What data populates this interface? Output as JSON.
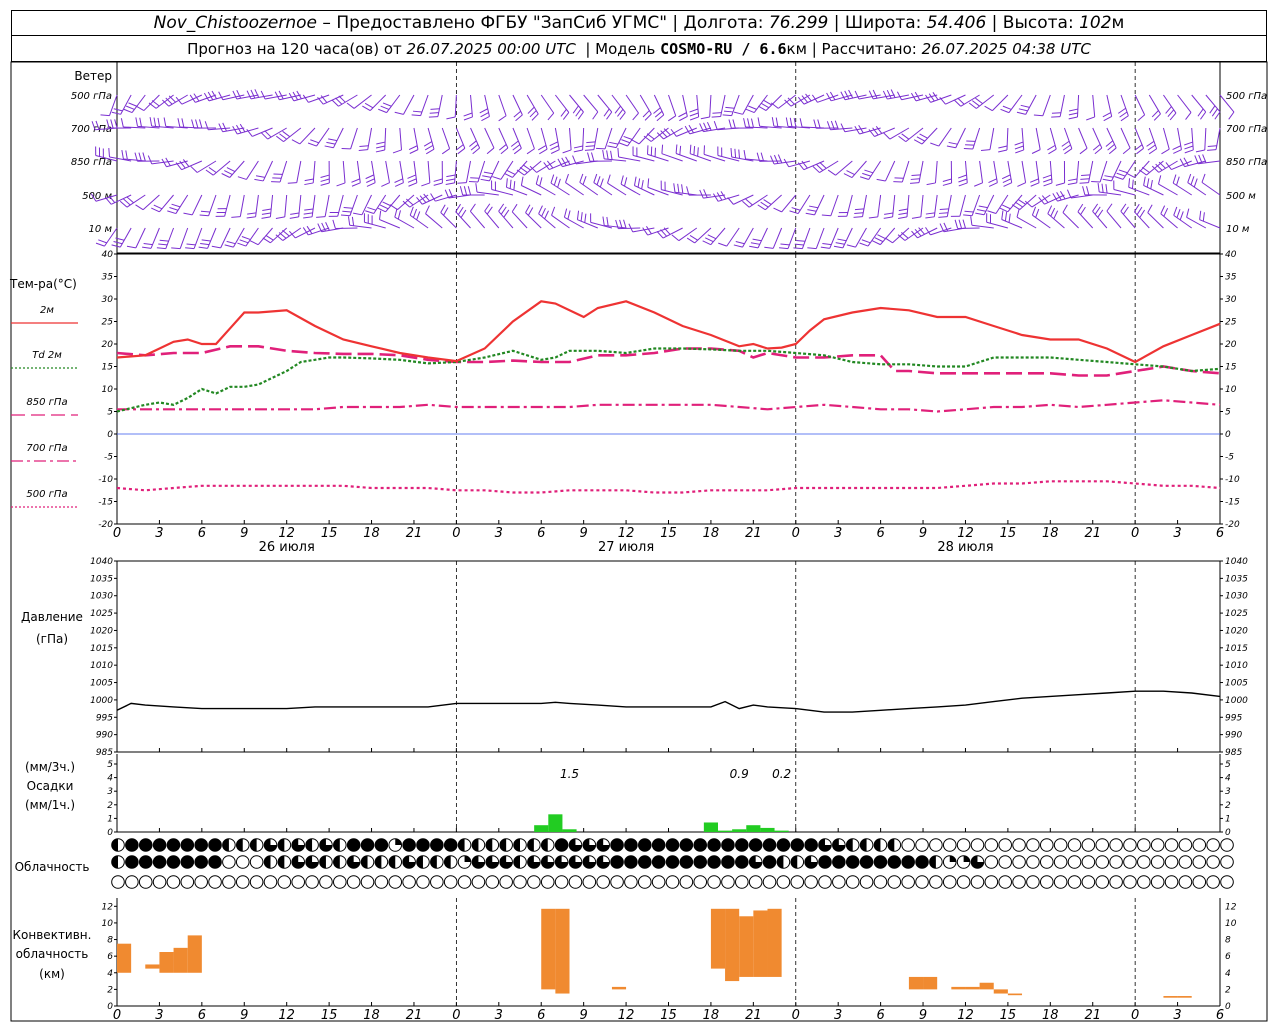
{
  "header": {
    "station": "Nov_Chistoozernoe",
    "provider": " – Предоставлено ФГБУ \"ЗапСиб УГМС\" | Долгота: ",
    "lon": "76.299",
    "lat_label": " | Широта: ",
    "lat": "54.406",
    "alt_label": " | Высота: ",
    "alt": "102",
    "alt_unit": "м",
    "forecast_prefix": "Прогноз на 120 часа(ов) от ",
    "forecast_from": "26.07.2025 00:00 UTC",
    "model_label": "  | Модель ",
    "model": "COSMO-RU / 6.6",
    "model_unit": "км",
    "calc_label": " | Рассчитано: ",
    "calc_time": "26.07.2025 04:38 UTC"
  },
  "wind_panel": {
    "title": "Ветер",
    "levels": [
      "500 гПа",
      "700 гПа",
      "850 гПа",
      "500 м",
      "10  м"
    ],
    "colors": {
      "barb": "#7a2ed0"
    }
  },
  "temp_panel": {
    "title": "Тем-ра(°C)",
    "legend": [
      {
        "label": "2м",
        "color": "#ee3333",
        "style": "solid"
      },
      {
        "label": "Td  2м",
        "color": "#228822",
        "style": "dotted"
      },
      {
        "label": "850 гПа",
        "color": "#e0207a",
        "style": "longdash"
      },
      {
        "label": "700 гПа",
        "color": "#e0207a",
        "style": "dashdot"
      },
      {
        "label": "500 гПа",
        "color": "#e0207a",
        "style": "dotted"
      }
    ]
  },
  "time_axis": {
    "tick_labels": [
      "0",
      "3",
      "6",
      "9",
      "12",
      "15",
      "18",
      "21",
      "0",
      "3",
      "6",
      "9",
      "12",
      "15",
      "18",
      "21",
      "0",
      "3",
      "6",
      "9",
      "12",
      "15",
      "18",
      "21",
      "0",
      "3",
      "6"
    ],
    "day_labels": [
      "26 июля",
      "27 июля",
      "28 июля"
    ]
  },
  "pressure_panel": {
    "title": "Давление",
    "unit": "(гПа)"
  },
  "precip_panel": {
    "unit_top": "(мм/3ч.)",
    "title": "Осадки",
    "unit_bottom": "(мм/1ч.)",
    "annotations": [
      {
        "hour": 32,
        "text": "1.5"
      },
      {
        "hour": 44,
        "text": "0.9"
      },
      {
        "hour": 47,
        "text": "0.2"
      }
    ]
  },
  "cloud_panel": {
    "title": "Облачность",
    "rows": [
      "2444444422232323244414444222222243334444444444444443322220000000000000000000000000000003113",
      "2444444400022332232223222133323333334444444444342234444444421130000000000000000000000000000113",
      "0000000000000000000000000000000000000000000000000000000000000000000000000000000000000000000000"
    ]
  },
  "conv_panel": {
    "title_line1": "Конвективн.",
    "title_line2": "облачность",
    "unit": "(км)"
  },
  "colors": {
    "temp2m": "#ee3333",
    "td": "#228822",
    "upper": "#e0207a",
    "precip": "#22cc22",
    "conv": "#f08a30",
    "zero_line": "#3355ee"
  },
  "chart_data": [
    {
      "type": "line",
      "title": "Тем-ра(°C)",
      "x_unit": "hours from 26.07.2025 00:00 UTC",
      "ylim": [
        -20,
        40
      ],
      "series": [
        {
          "name": "2м",
          "x": [
            0,
            2,
            4,
            5,
            6,
            7,
            8,
            9,
            10,
            12,
            14,
            16,
            18,
            20,
            22,
            24,
            26,
            28,
            30,
            31,
            33,
            34,
            36,
            38,
            40,
            42,
            44,
            45,
            46,
            47,
            48,
            49,
            50,
            52,
            54,
            56,
            58,
            60,
            62,
            63,
            64,
            66,
            68,
            70,
            72,
            74,
            76,
            78
          ],
          "y": [
            17,
            17.5,
            20.5,
            21,
            20,
            20,
            23.5,
            27,
            27,
            27.5,
            24,
            21,
            19.5,
            18,
            17,
            16.2,
            19,
            25,
            29.5,
            29,
            26,
            28,
            29.5,
            27,
            24,
            22,
            19.5,
            20,
            19,
            19.2,
            20,
            23,
            25.5,
            27,
            28,
            27.5,
            26,
            26,
            24,
            23,
            22,
            21,
            21,
            19,
            16,
            19.5,
            22,
            24.5
          ]
        },
        {
          "name": "Td 2м",
          "x": [
            0,
            2,
            3,
            4,
            5,
            6,
            7,
            8,
            9,
            10,
            12,
            13,
            14,
            15,
            16,
            18,
            20,
            22,
            24,
            26,
            28,
            30,
            31,
            32,
            34,
            36,
            38,
            40,
            42,
            44,
            46,
            48,
            50,
            52,
            54,
            56,
            58,
            60,
            62,
            64,
            66,
            68,
            70,
            72,
            74,
            76,
            78
          ],
          "y": [
            5,
            6.5,
            7,
            6.5,
            8,
            10,
            9,
            10.5,
            10.5,
            11,
            14,
            16,
            16.5,
            17,
            17,
            16.8,
            16.5,
            15.7,
            16,
            17,
            18.5,
            16.5,
            17,
            18.5,
            18.5,
            18,
            19,
            19,
            18.8,
            18.5,
            18.5,
            18,
            17.5,
            16,
            15.5,
            15.5,
            15,
            15,
            17,
            17,
            17,
            16.5,
            16,
            15.5,
            15,
            14,
            14.5
          ]
        },
        {
          "name": "850 гПа",
          "x": [
            0,
            2,
            4,
            6,
            8,
            10,
            12,
            14,
            16,
            18,
            20,
            22,
            24,
            26,
            28,
            30,
            32,
            34,
            36,
            38,
            40,
            42,
            44,
            45,
            46,
            48,
            50,
            52,
            54,
            55,
            56,
            58,
            60,
            62,
            64,
            66,
            68,
            70,
            72,
            74,
            76,
            78
          ],
          "y": [
            18,
            17.5,
            18,
            18,
            19.5,
            19.5,
            18.5,
            18,
            17.8,
            17.8,
            17.5,
            16.5,
            16,
            16,
            16.3,
            16,
            16,
            17.5,
            17.5,
            18,
            19,
            19,
            18.5,
            17,
            18,
            17,
            17,
            17.5,
            17.5,
            14,
            14,
            13.5,
            13.5,
            13.5,
            13.5,
            13.5,
            13,
            13,
            14,
            15,
            14,
            13.5
          ]
        },
        {
          "name": "700 гПа",
          "x": [
            0,
            2,
            4,
            6,
            8,
            10,
            12,
            14,
            16,
            18,
            20,
            22,
            24,
            26,
            28,
            30,
            32,
            34,
            36,
            38,
            40,
            42,
            44,
            46,
            48,
            50,
            52,
            54,
            56,
            58,
            60,
            62,
            64,
            66,
            68,
            70,
            72,
            74,
            76,
            78
          ],
          "y": [
            5.5,
            5.5,
            5.5,
            5.5,
            5.5,
            5.5,
            5.5,
            5.5,
            6,
            6,
            6,
            6.5,
            6,
            6,
            6,
            6,
            6,
            6.5,
            6.5,
            6.5,
            6.5,
            6.5,
            6,
            5.5,
            6,
            6.5,
            6,
            5.5,
            5.5,
            5,
            5.5,
            6,
            6,
            6.5,
            6,
            6.5,
            7,
            7.5,
            7,
            6.5
          ]
        },
        {
          "name": "500 гПа",
          "x": [
            0,
            2,
            4,
            6,
            8,
            10,
            12,
            14,
            16,
            18,
            20,
            22,
            24,
            26,
            28,
            30,
            32,
            34,
            36,
            38,
            40,
            42,
            44,
            46,
            48,
            50,
            52,
            54,
            56,
            58,
            60,
            62,
            64,
            66,
            68,
            70,
            72,
            74,
            76,
            78
          ],
          "y": [
            -12,
            -12.5,
            -12,
            -11.5,
            -11.5,
            -11.5,
            -11.5,
            -11.5,
            -11.5,
            -12,
            -12,
            -12,
            -12.5,
            -12.5,
            -13,
            -13,
            -12.5,
            -12.5,
            -12.5,
            -13,
            -13,
            -12.5,
            -12.5,
            -12.5,
            -12,
            -12,
            -12,
            -12,
            -12,
            -12,
            -11.5,
            -11,
            -11,
            -10.5,
            -10.5,
            -10.5,
            -11,
            -11.5,
            -11.5,
            -12
          ]
        }
      ]
    },
    {
      "type": "line",
      "title": "Давление",
      "ylim": [
        985,
        1040
      ],
      "series": [
        {
          "name": "pressure",
          "x": [
            0,
            1,
            2,
            4,
            6,
            8,
            10,
            12,
            14,
            16,
            18,
            20,
            22,
            24,
            26,
            28,
            30,
            31,
            32,
            34,
            36,
            38,
            40,
            42,
            43,
            44,
            45,
            46,
            48,
            50,
            52,
            54,
            56,
            58,
            60,
            62,
            64,
            66,
            68,
            70,
            72,
            74,
            76,
            78
          ],
          "y": [
            997,
            999,
            998.5,
            998,
            997.5,
            997.5,
            997.5,
            997.5,
            998,
            998,
            998,
            998,
            998,
            999,
            999,
            999,
            999,
            999.3,
            999,
            998.5,
            998,
            998,
            998,
            998,
            999.5,
            997.5,
            998.5,
            998,
            997.5,
            996.5,
            996.5,
            997,
            997.5,
            998,
            998.5,
            999.5,
            1000.5,
            1001,
            1001.5,
            1002,
            1002.5,
            1002.5,
            1002,
            1001
          ]
        }
      ]
    },
    {
      "type": "bar",
      "title": "Осадки",
      "ylim": [
        0,
        5
      ],
      "series": [
        {
          "name": "precip 1h",
          "x": [
            30,
            31,
            32,
            42,
            43,
            44,
            45,
            46,
            47
          ],
          "y": [
            0.5,
            1.3,
            0.2,
            0.7,
            0.1,
            0.2,
            0.5,
            0.3,
            0.1
          ]
        }
      ]
    },
    {
      "type": "bar",
      "title": "Конвективн. облачность",
      "ylim": [
        0,
        13
      ],
      "series": [
        {
          "name": "base_top_km",
          "x": [
            0.5,
            2.5,
            3.5,
            4.5,
            5.5,
            30.5,
            31.5,
            35.5,
            42.5,
            43.5,
            44.5,
            45.5,
            46.5,
            56.5,
            57.5,
            59.5,
            60.5,
            61.5,
            62.5,
            63.5,
            74.5,
            75.5
          ],
          "base": [
            4,
            4.5,
            4,
            4,
            4,
            2,
            1.5,
            2,
            4.5,
            3,
            3.5,
            3.5,
            3.5,
            2,
            2,
            2,
            2,
            2,
            1.5,
            1.3,
            1,
            1
          ],
          "top": [
            7.5,
            5,
            6.5,
            7,
            8.5,
            11.7,
            11.7,
            2.3,
            11.7,
            11.7,
            10.8,
            11.5,
            11.7,
            3.5,
            3.5,
            2.3,
            2.3,
            2.8,
            2,
            1.5,
            1.2,
            1.2
          ]
        }
      ]
    }
  ]
}
